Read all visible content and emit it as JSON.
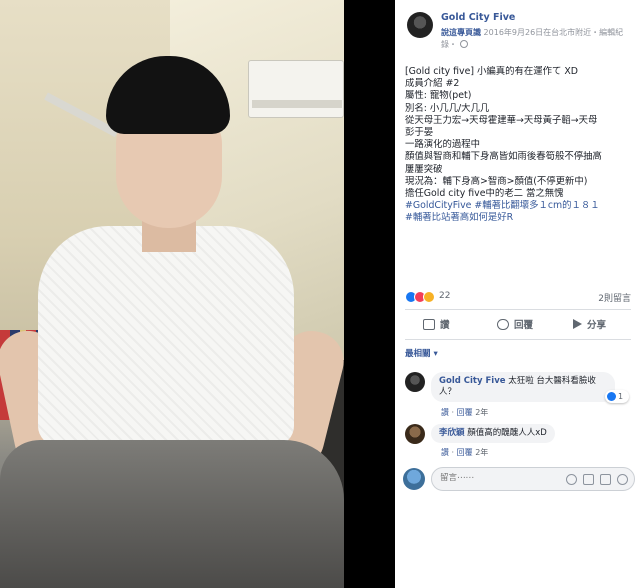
{
  "post": {
    "page_name": "Gold City Five",
    "poster": "說這專頁識",
    "meta_line": "2016年9月26日在台北市附近・編輯紀錄・",
    "body_lines": [
      {
        "text": "[Gold city five] 小編真的有在運作て XD",
        "type": "text"
      },
      {
        "text": "成員介紹 #2",
        "type": "text"
      },
      {
        "text": "屬性: 寵物(pet)",
        "type": "text"
      },
      {
        "text": "別名: 小几几/大几几",
        "type": "text"
      },
      {
        "text": "從天母王力宏→天母霍建華→天母黃子韜→天母",
        "type": "text"
      },
      {
        "text": "彭于晏",
        "type": "text"
      },
      {
        "text": "一路演化的過程中",
        "type": "text"
      },
      {
        "text": "顏值與智商和輔下身高皆如雨後春筍般不停抽高",
        "type": "text"
      },
      {
        "text": "屢屢突破",
        "type": "text"
      },
      {
        "text": "現況為：輔下身高>智商>顏值(不停更新中)",
        "type": "text"
      },
      {
        "text": "擔任Gold city five中的老二 當之無愧",
        "type": "text"
      },
      {
        "text": "#GoldCityFive #輔著比翻壞多１cm的１８１",
        "type": "hashtag"
      },
      {
        "text": "#輔著比站著高如何是好R",
        "type": "hashtag"
      }
    ],
    "reaction_count": "22",
    "comment_count": "2則留言"
  },
  "actions": {
    "like": "讚",
    "comment": "回覆",
    "share": "分享"
  },
  "relevant_label": "最相關 ▾",
  "comments": [
    {
      "author": "Gold City Five",
      "text": "太狂啦 台大醫科看臉收人？",
      "like": "讚",
      "reply": "回覆",
      "time": "2年",
      "like_badge": "1"
    },
    {
      "author": "李欣穎",
      "text": "顏值高的醜醜人人xD",
      "like": "讚",
      "reply": "回覆",
      "time": "2年"
    }
  ],
  "composer": {
    "placeholder": "留言⋯⋯"
  },
  "colors": {
    "link": "#385898",
    "like_blue": "#1877f2",
    "text": "#1d2129",
    "muted": "#606770"
  },
  "icons": [
    "globe-icon",
    "like-icon",
    "comment-icon",
    "share-icon",
    "emoji-icon",
    "camera-icon",
    "gif-icon",
    "sticker-icon"
  ]
}
